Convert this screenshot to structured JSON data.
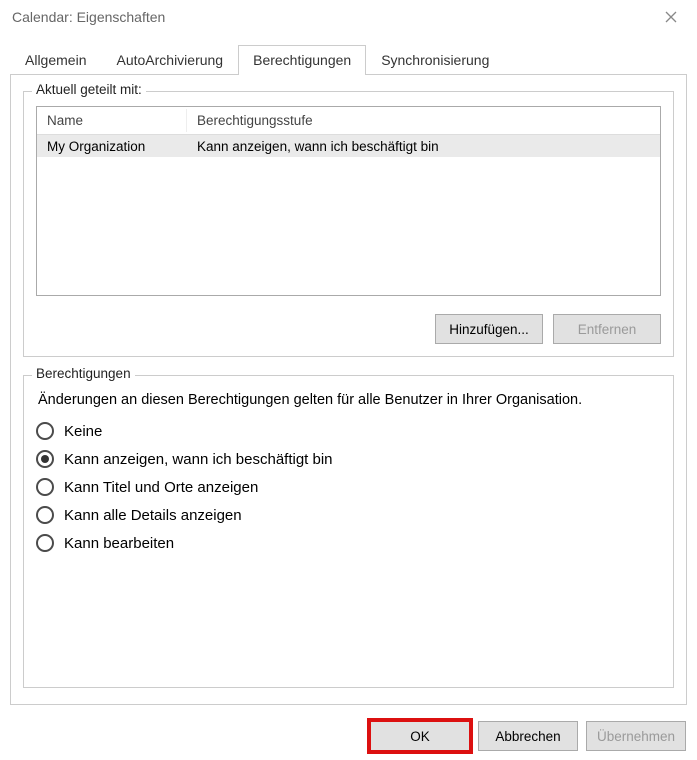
{
  "window": {
    "title": "Calendar: Eigenschaften"
  },
  "tabs": {
    "t0": "Allgemein",
    "t1": "AutoArchivierung",
    "t2": "Berechtigungen",
    "t3": "Synchronisierung",
    "active_index": 2
  },
  "shared": {
    "legend": "Aktuell geteilt mit:",
    "col_name": "Name",
    "col_level": "Berechtigungsstufe",
    "rows": [
      {
        "name": "My Organization",
        "level": "Kann anzeigen, wann ich beschäftigt bin"
      }
    ],
    "add_btn": "Hinzufügen...",
    "remove_btn": "Entfernen"
  },
  "perms": {
    "legend": "Berechtigungen",
    "desc": "Änderungen an diesen Berechtigungen gelten für alle Benutzer in Ihrer Organisation.",
    "options": {
      "o0": "Keine",
      "o1": "Kann anzeigen, wann ich beschäftigt bin",
      "o2": "Kann Titel und Orte anzeigen",
      "o3": "Kann alle Details anzeigen",
      "o4": "Kann bearbeiten"
    },
    "selected_index": 1
  },
  "footer": {
    "ok": "OK",
    "cancel": "Abbrechen",
    "apply": "Übernehmen"
  }
}
